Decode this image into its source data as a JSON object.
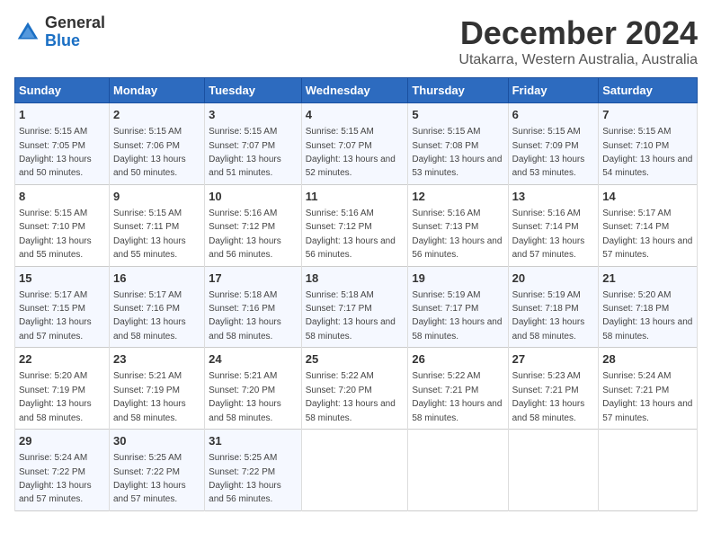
{
  "header": {
    "logo_general": "General",
    "logo_blue": "Blue",
    "title": "December 2024",
    "subtitle": "Utakarra, Western Australia, Australia"
  },
  "days_of_week": [
    "Sunday",
    "Monday",
    "Tuesday",
    "Wednesday",
    "Thursday",
    "Friday",
    "Saturday"
  ],
  "weeks": [
    [
      {
        "day": "1",
        "sunrise": "5:15 AM",
        "sunset": "7:05 PM",
        "daylight": "13 hours and 50 minutes."
      },
      {
        "day": "2",
        "sunrise": "5:15 AM",
        "sunset": "7:06 PM",
        "daylight": "13 hours and 50 minutes."
      },
      {
        "day": "3",
        "sunrise": "5:15 AM",
        "sunset": "7:07 PM",
        "daylight": "13 hours and 51 minutes."
      },
      {
        "day": "4",
        "sunrise": "5:15 AM",
        "sunset": "7:07 PM",
        "daylight": "13 hours and 52 minutes."
      },
      {
        "day": "5",
        "sunrise": "5:15 AM",
        "sunset": "7:08 PM",
        "daylight": "13 hours and 53 minutes."
      },
      {
        "day": "6",
        "sunrise": "5:15 AM",
        "sunset": "7:09 PM",
        "daylight": "13 hours and 53 minutes."
      },
      {
        "day": "7",
        "sunrise": "5:15 AM",
        "sunset": "7:10 PM",
        "daylight": "13 hours and 54 minutes."
      }
    ],
    [
      {
        "day": "8",
        "sunrise": "5:15 AM",
        "sunset": "7:10 PM",
        "daylight": "13 hours and 55 minutes."
      },
      {
        "day": "9",
        "sunrise": "5:15 AM",
        "sunset": "7:11 PM",
        "daylight": "13 hours and 55 minutes."
      },
      {
        "day": "10",
        "sunrise": "5:16 AM",
        "sunset": "7:12 PM",
        "daylight": "13 hours and 56 minutes."
      },
      {
        "day": "11",
        "sunrise": "5:16 AM",
        "sunset": "7:12 PM",
        "daylight": "13 hours and 56 minutes."
      },
      {
        "day": "12",
        "sunrise": "5:16 AM",
        "sunset": "7:13 PM",
        "daylight": "13 hours and 56 minutes."
      },
      {
        "day": "13",
        "sunrise": "5:16 AM",
        "sunset": "7:14 PM",
        "daylight": "13 hours and 57 minutes."
      },
      {
        "day": "14",
        "sunrise": "5:17 AM",
        "sunset": "7:14 PM",
        "daylight": "13 hours and 57 minutes."
      }
    ],
    [
      {
        "day": "15",
        "sunrise": "5:17 AM",
        "sunset": "7:15 PM",
        "daylight": "13 hours and 57 minutes."
      },
      {
        "day": "16",
        "sunrise": "5:17 AM",
        "sunset": "7:16 PM",
        "daylight": "13 hours and 58 minutes."
      },
      {
        "day": "17",
        "sunrise": "5:18 AM",
        "sunset": "7:16 PM",
        "daylight": "13 hours and 58 minutes."
      },
      {
        "day": "18",
        "sunrise": "5:18 AM",
        "sunset": "7:17 PM",
        "daylight": "13 hours and 58 minutes."
      },
      {
        "day": "19",
        "sunrise": "5:19 AM",
        "sunset": "7:17 PM",
        "daylight": "13 hours and 58 minutes."
      },
      {
        "day": "20",
        "sunrise": "5:19 AM",
        "sunset": "7:18 PM",
        "daylight": "13 hours and 58 minutes."
      },
      {
        "day": "21",
        "sunrise": "5:20 AM",
        "sunset": "7:18 PM",
        "daylight": "13 hours and 58 minutes."
      }
    ],
    [
      {
        "day": "22",
        "sunrise": "5:20 AM",
        "sunset": "7:19 PM",
        "daylight": "13 hours and 58 minutes."
      },
      {
        "day": "23",
        "sunrise": "5:21 AM",
        "sunset": "7:19 PM",
        "daylight": "13 hours and 58 minutes."
      },
      {
        "day": "24",
        "sunrise": "5:21 AM",
        "sunset": "7:20 PM",
        "daylight": "13 hours and 58 minutes."
      },
      {
        "day": "25",
        "sunrise": "5:22 AM",
        "sunset": "7:20 PM",
        "daylight": "13 hours and 58 minutes."
      },
      {
        "day": "26",
        "sunrise": "5:22 AM",
        "sunset": "7:21 PM",
        "daylight": "13 hours and 58 minutes."
      },
      {
        "day": "27",
        "sunrise": "5:23 AM",
        "sunset": "7:21 PM",
        "daylight": "13 hours and 58 minutes."
      },
      {
        "day": "28",
        "sunrise": "5:24 AM",
        "sunset": "7:21 PM",
        "daylight": "13 hours and 57 minutes."
      }
    ],
    [
      {
        "day": "29",
        "sunrise": "5:24 AM",
        "sunset": "7:22 PM",
        "daylight": "13 hours and 57 minutes."
      },
      {
        "day": "30",
        "sunrise": "5:25 AM",
        "sunset": "7:22 PM",
        "daylight": "13 hours and 57 minutes."
      },
      {
        "day": "31",
        "sunrise": "5:25 AM",
        "sunset": "7:22 PM",
        "daylight": "13 hours and 56 minutes."
      },
      null,
      null,
      null,
      null
    ]
  ]
}
